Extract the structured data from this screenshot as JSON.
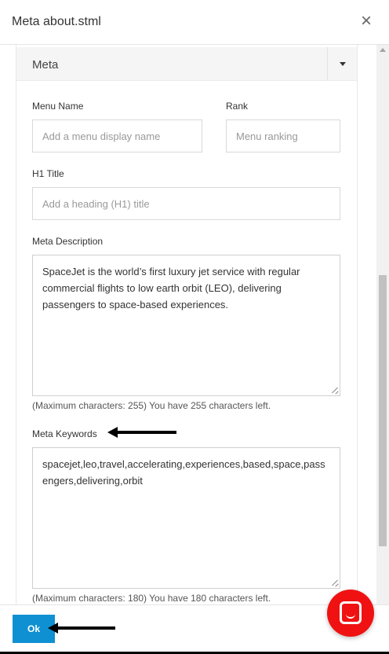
{
  "dialog": {
    "title": "Meta about.stml",
    "close_glyph": "×"
  },
  "panel": {
    "title": "Meta"
  },
  "form": {
    "menu_name": {
      "label": "Menu Name",
      "value": "",
      "placeholder": "Add a menu display name"
    },
    "rank": {
      "label": "Rank",
      "value": "",
      "placeholder": "Menu ranking"
    },
    "h1_title": {
      "label": "H1 Title",
      "value": "",
      "placeholder": "Add a heading (H1) title"
    },
    "meta_description": {
      "label": "Meta Description",
      "value": "SpaceJet is the world’s first luxury jet service with regular commercial flights to low earth orbit (LEO), delivering passengers to space-based experiences.",
      "hint": "(Maximum characters: 255) You have 255 characters left."
    },
    "meta_keywords": {
      "label": "Meta Keywords",
      "value": "spacejet,leo,travel,accelerating,experiences,based,space,passengers,delivering,orbit",
      "hint": "(Maximum characters: 180) You have 180 characters left."
    }
  },
  "footer": {
    "ok_label": "Ok"
  },
  "colors": {
    "ok_button": "#0e90d2",
    "chat_launcher": "#f01212"
  },
  "icons": {
    "close": "close-icon",
    "panel_toggle": "caret-down-icon",
    "chat": "chat-bubble-icon",
    "annotation": "arrow-left-icon"
  }
}
